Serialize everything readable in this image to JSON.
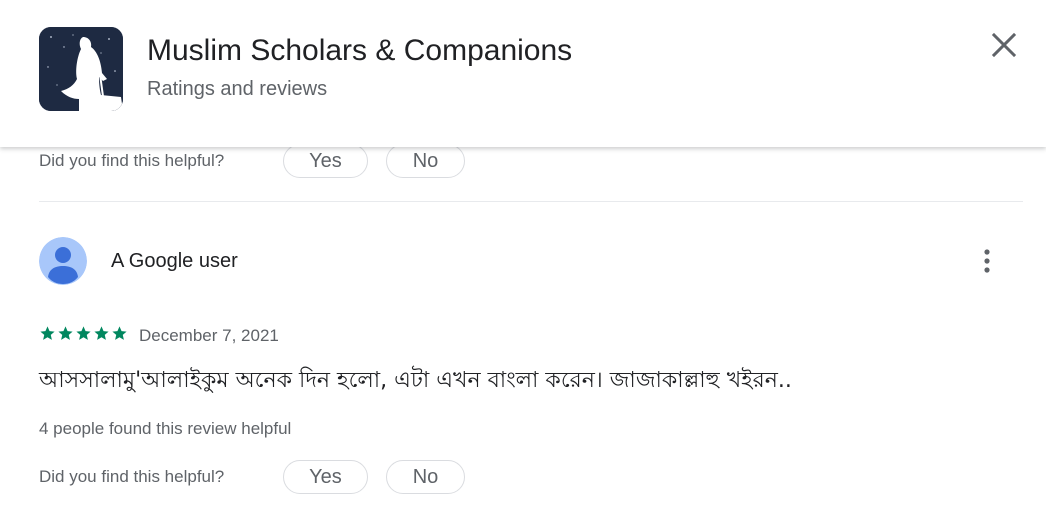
{
  "header": {
    "app_icon": "app-icon-scholar-silhouette",
    "title": "Muslim Scholars & Companions",
    "subtitle": "Ratings and reviews",
    "close_icon": "close-icon"
  },
  "previous_review": {
    "helpful_question": "Did you find this helpful?",
    "yes_label": "Yes",
    "no_label": "No"
  },
  "review": {
    "avatar_icon": "default-user-avatar",
    "author": "A Google user",
    "more_icon": "more-vert-icon",
    "rating": 5,
    "rating_max": 5,
    "date": "December 7, 2021",
    "text": "আসসালামু'আলাইকুম অনেক দিন হলো, এটা এখন বাংলা করেন। জাজাকাল্লাহু খইরন..",
    "helpful_count_text": "4 people found this review helpful",
    "helpful_question": "Did you find this helpful?",
    "yes_label": "Yes",
    "no_label": "No"
  },
  "colors": {
    "star": "#01875f",
    "text_primary": "#202124",
    "text_secondary": "#5f6368",
    "avatar_bg": "#a8c7fa",
    "avatar_fg": "#3b6fd8"
  }
}
